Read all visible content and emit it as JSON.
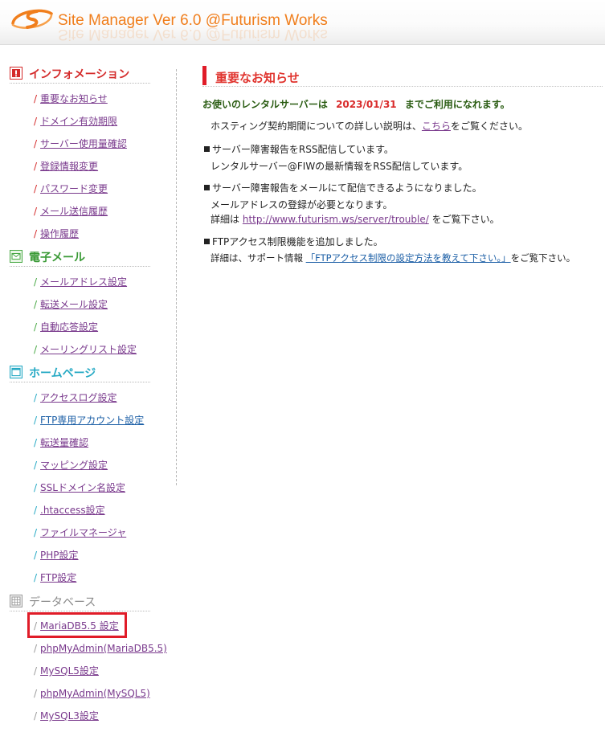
{
  "app": {
    "title": "Site Manager Ver 6.0 @Futurism Works"
  },
  "colors": {
    "accent_orange": "#f07e1c",
    "accent_red": "#e01c28",
    "info_red": "#d42a2a",
    "mail_green": "#48a844",
    "home_cyan": "#25a9c4",
    "db_gray": "#9a9a9a",
    "link_purple": "#7a3a8d",
    "link_blue": "#1c5fa6"
  },
  "sidebar": {
    "sections": [
      {
        "title": "インフォメーション",
        "icon": "alert-icon",
        "items": [
          "重要なお知らせ",
          "ドメイン有効期限",
          "サーバー使用量確認",
          "登録情報変更",
          "パスワード変更",
          "メール送信履歴",
          "操作履歴"
        ]
      },
      {
        "title": "電子メール",
        "icon": "envelope-icon",
        "items": [
          "メールアドレス設定",
          "転送メール設定",
          "自動応答設定",
          "メーリングリスト設定"
        ]
      },
      {
        "title": "ホームページ",
        "icon": "window-icon",
        "items": [
          "アクセスログ設定",
          "FTP専用アカウント設定",
          "転送量確認",
          "マッピング設定",
          "SSLドメイン名設定",
          ".htaccess設定",
          "ファイルマネージャ",
          "PHP設定",
          "FTP設定"
        ]
      },
      {
        "title": "データベース",
        "icon": "database-grid-icon",
        "items": [
          "MariaDB5.5 設定",
          "phpMyAdmin(MariaDB5.5)",
          "MySQL5設定",
          "phpMyAdmin(MySQL5)",
          "MySQL3設定"
        ]
      }
    ],
    "slash": "/"
  },
  "main": {
    "heading": "重要なお知らせ",
    "usage": {
      "prefix": "お使いのレンタルサーバーは",
      "date": "2023/01/31",
      "suffix": "までご利用になれます。"
    },
    "hosting": {
      "prefix": "ホスティング契約期間についての詳しい説明は、",
      "link": "こちら",
      "suffix": "をご覧ください。"
    },
    "notices": [
      {
        "title": "サーバー障害報告をRSS配信しています。",
        "line1": "レンタルサーバー@FIWの最新情報をRSS配信しています。"
      },
      {
        "title": "サーバー障害報告をメールにて配信できるようになりました。",
        "line1": "メールアドレスの登録が必要となります。",
        "line2_prefix": "詳細は",
        "line2_link": "http://www.futurism.ws/server/trouble/",
        "line2_suffix": "をご覧下さい。"
      },
      {
        "title": "FTPアクセス制限機能を追加しました。",
        "line1_prefix": "詳細は、サポート情報",
        "line1_link": "「FTPアクセス制限の設定方法を教えて下さい。」",
        "line1_suffix": "をご覧下さい。"
      }
    ]
  }
}
